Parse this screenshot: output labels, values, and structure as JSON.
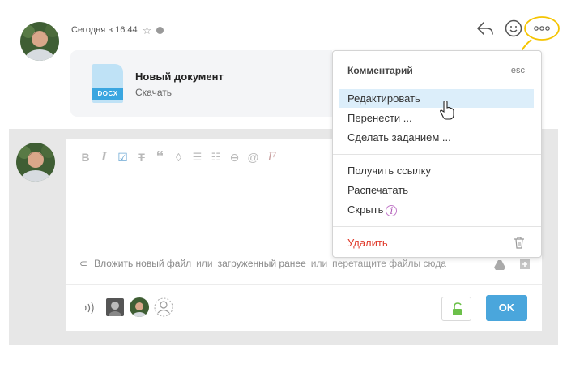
{
  "post": {
    "timestamp": "Сегодня в 16:44",
    "attachment": {
      "name": "Новый документ",
      "download_label": "Скачать",
      "type_badge": "DOCX"
    }
  },
  "header_icons": [
    "reply-icon",
    "emoji-icon",
    "more-options-icon"
  ],
  "editor": {
    "toolbar": {
      "bold": "B",
      "italic": "I",
      "checkbox": "☑",
      "strike": "T",
      "quote": "“",
      "color": "◊",
      "bullets": "☰",
      "numbered": "☷",
      "link": "⊖",
      "mention": "@",
      "clear": "F"
    },
    "attach_line": {
      "new_file_link": "Вложить новый файл",
      "or1": "или",
      "uploaded_link": "загруженный ранее",
      "or2": "или",
      "drag_text": "перетащите файлы сюда"
    },
    "submit_label": "OK"
  },
  "context_menu": {
    "title": "Комментарий",
    "esc_label": "esc",
    "items": [
      {
        "label": "Редактировать",
        "hover": true
      },
      {
        "label": "Перенести ..."
      },
      {
        "label": "Сделать заданием ..."
      }
    ],
    "items2": [
      {
        "label": "Получить ссылку"
      },
      {
        "label": "Распечатать"
      },
      {
        "label": "Скрыть"
      }
    ],
    "delete_label": "Удалить",
    "info_glyph": "i"
  },
  "colors": {
    "accent": "#4aa6dc",
    "highlight": "#f5c400",
    "danger": "#e03b2c",
    "menu_hover": "#dceefa"
  }
}
